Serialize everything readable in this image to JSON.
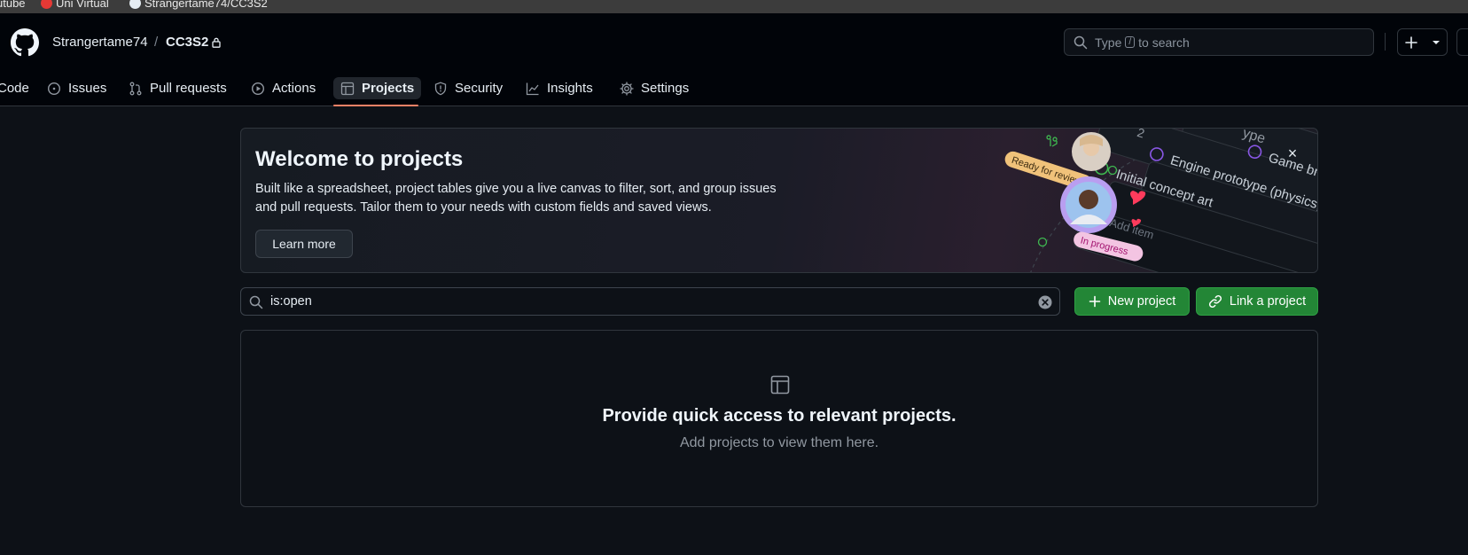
{
  "bookmarks": [
    {
      "label": "utube",
      "icon": "youtube-icon"
    },
    {
      "label": "Uni Virtual",
      "icon": "uni-virtual-icon"
    },
    {
      "label": "Strangertame74/CC3S2",
      "icon": "github-icon"
    }
  ],
  "header": {
    "owner": "Strangertame74",
    "separator": "/",
    "repo": "CC3S2",
    "search_prefix": "Type",
    "search_key": "/",
    "search_suffix": "to search"
  },
  "tabs": [
    {
      "label": "Code",
      "icon": "code-icon"
    },
    {
      "label": "Issues",
      "icon": "issue-icon"
    },
    {
      "label": "Pull requests",
      "icon": "pull-request-icon"
    },
    {
      "label": "Actions",
      "icon": "play-icon"
    },
    {
      "label": "Projects",
      "icon": "table-icon",
      "active": true
    },
    {
      "label": "Security",
      "icon": "shield-icon"
    },
    {
      "label": "Insights",
      "icon": "graph-icon"
    },
    {
      "label": "Settings",
      "icon": "gear-icon"
    }
  ],
  "banner": {
    "title": "Welcome to projects",
    "description": "Built like a spreadsheet, project tables give you a live canvas to filter, sort, and group issues and pull requests. Tailor them to your needs with custom fields and saved views.",
    "learn_more": "Learn more",
    "art": {
      "row_2": "2",
      "row_3": "3",
      "item_1": "Game brief and go-no-go",
      "item_2": "Engine prototype (physics, rendering)",
      "item_3": "Initial concept art",
      "partial_label": "ype",
      "badge_count": "3",
      "add_item": "Add item",
      "tag_review": "Ready for review",
      "tag_progress": "In progress"
    }
  },
  "filter": {
    "value": "is:open",
    "new_project": "New project",
    "link_project": "Link a project"
  },
  "blankslate": {
    "title": "Provide quick access to relevant projects.",
    "subtitle": "Add projects to view them here."
  },
  "colors": {
    "accent_green": "#238636",
    "tab_underline": "#f78166",
    "background": "#0d1117"
  }
}
